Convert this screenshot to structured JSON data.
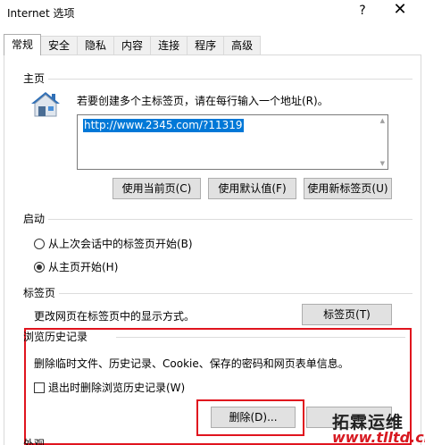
{
  "window": {
    "title": "Internet 选项",
    "help_label": "?",
    "close_label": "✕"
  },
  "tabs": [
    {
      "label": "常规",
      "active": true
    },
    {
      "label": "安全"
    },
    {
      "label": "隐私"
    },
    {
      "label": "内容"
    },
    {
      "label": "连接"
    },
    {
      "label": "程序"
    },
    {
      "label": "高级"
    }
  ],
  "home": {
    "heading": "主页",
    "description": "若要创建多个主标签页，请在每行输入一个地址(R)。",
    "url": "http://www.2345.com/?11319",
    "btn_current": "使用当前页(C)",
    "btn_default": "使用默认值(F)",
    "btn_new_tab": "使用新标签页(U)"
  },
  "startup": {
    "heading": "启动",
    "option_last": "从上次会话中的标签页开始(B)",
    "option_home": "从主页开始(H)",
    "selected": "home"
  },
  "tabs_section": {
    "heading": "标签页",
    "description": "更改网页在标签页中的显示方式。",
    "button": "标签页(T)"
  },
  "history": {
    "heading": "浏览历史记录",
    "description": "删除临时文件、历史记录、Cookie、保存的密码和网页表单信息。",
    "checkbox_label": "退出时删除浏览历史记录(W)",
    "checkbox_checked": false,
    "delete_button": "删除(D)..."
  },
  "appearance": {
    "heading": "外观"
  },
  "watermark": {
    "line1": "拓霖运维",
    "line2": "www.tlltd.cn"
  },
  "colors": {
    "highlight": "#e0141e",
    "selection": "#0078d7",
    "house_blue": "#2f6fb6"
  }
}
